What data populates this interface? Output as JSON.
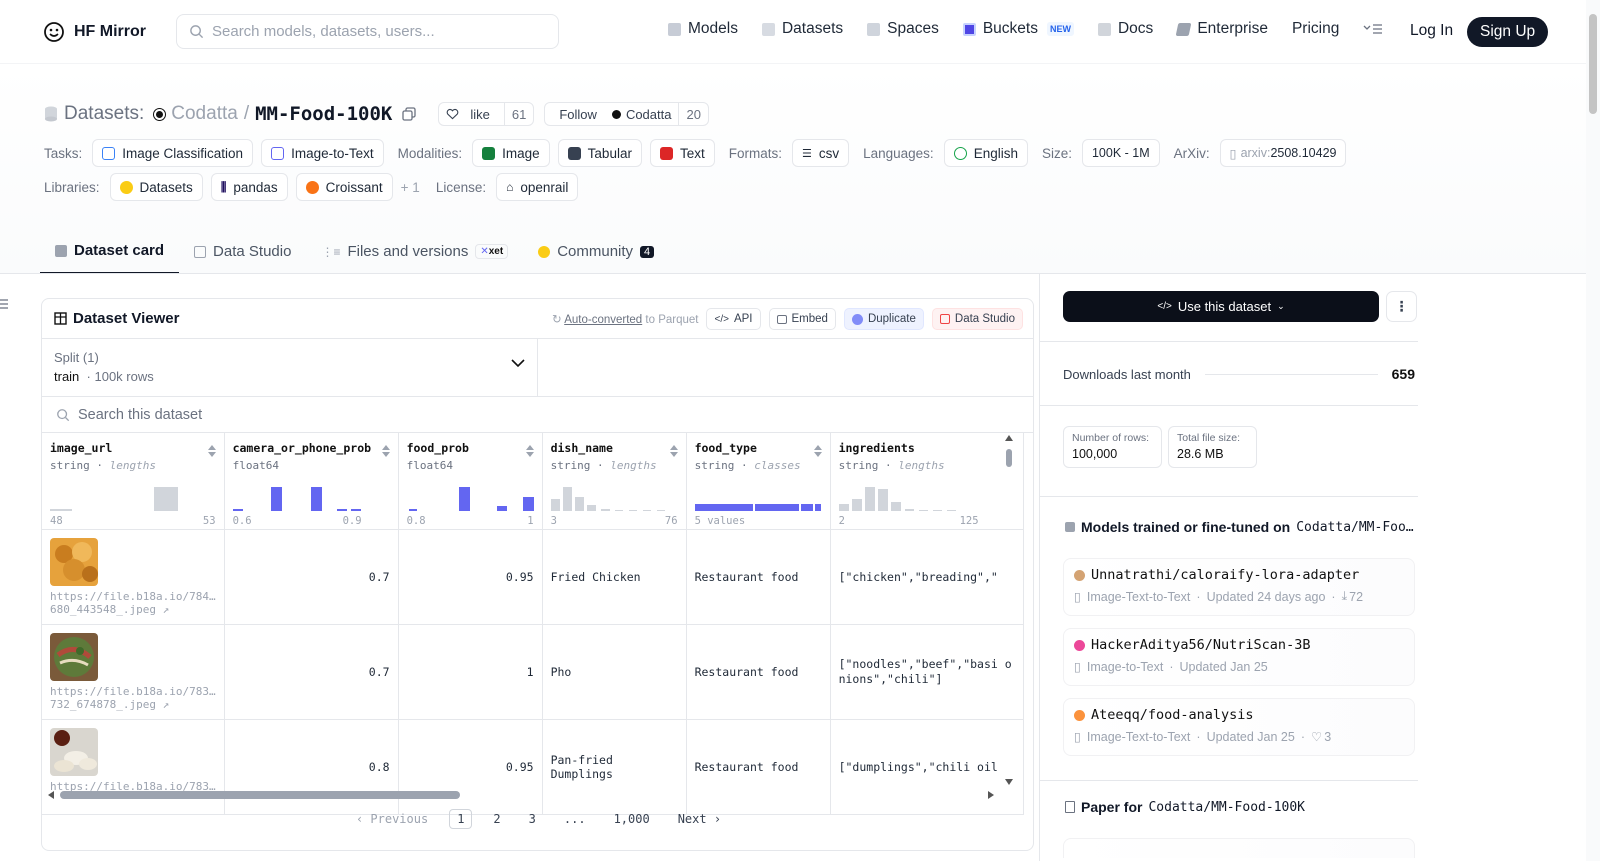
{
  "nav": {
    "brand": "HF Mirror",
    "search_placeholder": "Search models, datasets, users...",
    "links": [
      {
        "label": "Models",
        "icon": "cube-icon"
      },
      {
        "label": "Datasets",
        "icon": "database-icon"
      },
      {
        "label": "Spaces",
        "icon": "grid-icon"
      },
      {
        "label": "Buckets",
        "icon": "bucket-icon"
      },
      {
        "label": "Docs",
        "icon": "book-icon"
      },
      {
        "label": "Enterprise",
        "icon": "enterprise-icon"
      },
      {
        "label": "Pricing",
        "icon": ""
      }
    ],
    "new_badge": "NEW",
    "login": "Log In",
    "signup": "Sign Up"
  },
  "header": {
    "datasets_label": "Datasets:",
    "org": "Codatta",
    "sep": "/",
    "name": "MM-Food-100K",
    "like_label": "like",
    "like_count": "61",
    "follow_label": "Follow",
    "follow_org": "Codatta",
    "follow_count": "20",
    "tasks_label": "Tasks:",
    "tasks": [
      "Image Classification",
      "Image-to-Text"
    ],
    "modalities_label": "Modalities:",
    "modalities": [
      "Image",
      "Tabular",
      "Text"
    ],
    "formats_label": "Formats:",
    "formats": [
      "csv"
    ],
    "languages_label": "Languages:",
    "languages": [
      "English"
    ],
    "size_label": "Size:",
    "size": "100K - 1M",
    "arxiv_label": "ArXiv:",
    "arxiv_prefix": "arxiv:",
    "arxiv_id": "2508.10429",
    "libraries_label": "Libraries:",
    "libraries": [
      "Datasets",
      "pandas",
      "Croissant"
    ],
    "libraries_more": "+ 1",
    "license_label": "License:",
    "license": "openrail"
  },
  "tabs": [
    {
      "label": "Dataset card"
    },
    {
      "label": "Data Studio"
    },
    {
      "label": "Files and versions",
      "badge": "xet"
    },
    {
      "label": "Community",
      "badge": "4"
    }
  ],
  "viewer": {
    "title": "Dataset Viewer",
    "auto_converted": "Auto-converted",
    "to_parquet": "to Parquet",
    "api": "API",
    "embed": "Embed",
    "duplicate": "Duplicate",
    "data_studio": "Data Studio",
    "split_label": "Split (1)",
    "split_name": "train",
    "split_rows": "100k rows",
    "search_placeholder": "Search this dataset",
    "columns": [
      {
        "name": "image_url",
        "type": "string",
        "kind": "lengths",
        "min": "48",
        "max": "53"
      },
      {
        "name": "camera_or_phone_prob",
        "type": "float64",
        "kind": "",
        "min": "0.6",
        "max": "0.9"
      },
      {
        "name": "food_prob",
        "type": "float64",
        "kind": "",
        "min": "0.8",
        "max": "1"
      },
      {
        "name": "dish_name",
        "type": "string",
        "kind": "lengths",
        "min": "3",
        "max": "76"
      },
      {
        "name": "food_type",
        "type": "string",
        "kind": "classes",
        "min": "5 values",
        "max": ""
      },
      {
        "name": "ingredients",
        "type": "string",
        "kind": "lengths",
        "min": "2",
        "max": "125"
      }
    ],
    "rows": [
      {
        "url1": "https://file.b18a.io/784…",
        "url2": "680_443548_.jpeg",
        "camera": "0.7",
        "food": "0.95",
        "dish": "Fried Chicken",
        "type": "Restaurant food",
        "ingredients": "[\"chicken\",\"breading\",\""
      },
      {
        "url1": "https://file.b18a.io/783…",
        "url2": "732_674878_.jpeg",
        "camera": "0.7",
        "food": "1",
        "dish": "Pho",
        "type": "Restaurant food",
        "ingredients": "[\"noodles\",\"beef\",\"basi onions\",\"chili\"]"
      },
      {
        "url1": "https://file.b18a.io/783…",
        "url2": "",
        "camera": "0.8",
        "food": "0.95",
        "dish": "Pan-fried Dumplings",
        "type": "Restaurant food",
        "ingredients": "[\"dumplings\",\"chili oil"
      }
    ],
    "pager": {
      "prev": "Previous",
      "pages": [
        "1",
        "2",
        "3",
        "...",
        "1,000"
      ],
      "next": "Next"
    }
  },
  "sidebar": {
    "use_button": "Use this dataset",
    "downloads_label": "Downloads last month",
    "downloads_value": "659",
    "rows_label": "Number of rows:",
    "rows_value": "100,000",
    "size_label": "Total file size:",
    "size_value": "28.6 MB",
    "models_heading": "Models trained or fine-tuned on",
    "models_ref": "Codatta/MM-Foo…",
    "models": [
      {
        "name": "Unnatrathi/caloraify-lora-adapter",
        "task": "Image-Text-to-Text",
        "updated": "Updated 24 days ago",
        "extra": "72",
        "extra_icon": "download-icon",
        "avatar": "#d4a373"
      },
      {
        "name": "HackerAditya56/NutriScan-3B",
        "task": "Image-to-Text",
        "updated": "Updated Jan 25",
        "extra": "",
        "extra_icon": "",
        "avatar": "#ec4899"
      },
      {
        "name": "Ateeqq/food-analysis",
        "task": "Image-Text-to-Text",
        "updated": "Updated Jan 25",
        "extra": "3",
        "extra_icon": "heart-icon",
        "avatar": "#fb923c"
      }
    ],
    "paper_heading": "Paper for",
    "paper_ref": "Codatta/MM-Food-100K"
  }
}
